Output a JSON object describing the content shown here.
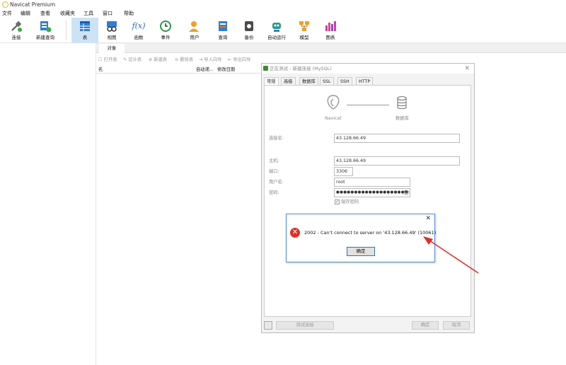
{
  "app": {
    "title": "Navicat Premium"
  },
  "menu": [
    "文件",
    "编辑",
    "查看",
    "收藏夹",
    "工具",
    "窗口",
    "帮助"
  ],
  "toolbar": {
    "items": [
      {
        "label": "连接",
        "icon": "connect-icon"
      },
      {
        "label": "新建查询",
        "icon": "new-query-icon"
      },
      {
        "label": "表",
        "icon": "table-icon"
      },
      {
        "label": "视图",
        "icon": "view-icon"
      },
      {
        "label": "函数",
        "icon": "function-icon",
        "glyph": "f(x)"
      },
      {
        "label": "事件",
        "icon": "event-icon"
      },
      {
        "label": "用户",
        "icon": "user-icon"
      },
      {
        "label": "查询",
        "icon": "query-icon"
      },
      {
        "label": "备份",
        "icon": "backup-icon"
      },
      {
        "label": "自动运行",
        "icon": "robot-icon"
      },
      {
        "label": "模型",
        "icon": "model-icon"
      },
      {
        "label": "图表",
        "icon": "chart-icon"
      }
    ]
  },
  "object_tab": "对象",
  "object_toolbar": [
    "打开表",
    "设计表",
    "新建表",
    "删除表",
    "导入向导",
    "导出向导"
  ],
  "columns": [
    "名",
    "自动递...",
    "修改日期"
  ],
  "dialog": {
    "title": "正在测试 - 新建连接 (MySQL)",
    "tabs": [
      "常规",
      "高级",
      "数据库",
      "SSL",
      "SSH",
      "HTTP"
    ],
    "navicat_label": "Navicat",
    "db_label": "数据库",
    "fields": {
      "conn_name_label": "连接名:",
      "conn_name": "43.128.66.49",
      "host_label": "主机:",
      "host": "43.128.66.49",
      "port_label": "端口:",
      "port": "3306",
      "user_label": "用户名:",
      "user": "root",
      "password_label": "密码:",
      "password": "●●●●●●●●●●●●●●●●●●●●",
      "save_password": "保存密码"
    },
    "buttons": {
      "test": "测试连接",
      "ok": "确定",
      "cancel": "取消"
    }
  },
  "error": {
    "message": "2002 - Can't connect to server on '43.128.66.49' (10061)",
    "ok": "确定"
  },
  "colors": {
    "accent": "#2a72c8",
    "error": "#e0302a",
    "annotation_arrow": "#e0302a"
  }
}
